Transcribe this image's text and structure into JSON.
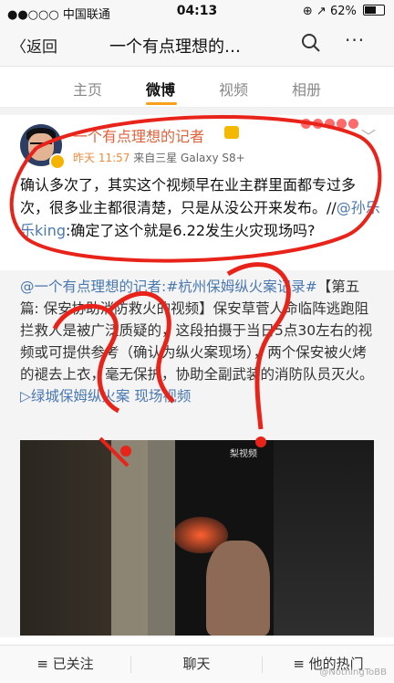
{
  "status_bar": {
    "carrier": "●●○○○ 中国联通",
    "wifi_icon": "wifi-icon",
    "time": "04:13",
    "indicators": "⊕ ↗",
    "battery_percent": "62%",
    "battery_level": 0.62
  },
  "nav": {
    "back_label": "〈返回",
    "title": "一个有点理想的…",
    "search_icon": "search-icon",
    "more_icon": "more-icon",
    "more_label": "···"
  },
  "tabs": [
    {
      "label": "主页"
    },
    {
      "label": "微博"
    },
    {
      "label": "视频"
    },
    {
      "label": "相册"
    }
  ],
  "post": {
    "username": "一个有点理想的记者",
    "time": "昨天 11:57",
    "source": "来自三星 Galaxy S8+",
    "body_prefix": "确认多次了，其实这个视频早在业主群里面都专过多次，很多业主都很清楚，只是从没公开来发布。//",
    "mention": "@孙乐乐king",
    "body_suffix": ":确定了这个就是6.22发生火灾现场吗?"
  },
  "repost": {
    "mention": "@一个有点理想的记者",
    "hashtag": ":#杭州保姆纵火案记录#",
    "text": "【第五篇: 保安协助消防救火的视频】保安草菅人命临阵逃跑阻拦救人是被广泛质疑的，这段拍摄于当日5点30左右的视频或可提供参考（确认为纵火案现场），两个保安被火烤的褪去上衣，毫无保护，协助全副武装的消防队员灭火。",
    "video_link": "▷绿城保姆纵火案 现场视频",
    "video_mark": "梨视频"
  },
  "bottom_bar": {
    "follow": "≡ 已关注",
    "chat": "聊天",
    "hot": "≡ 他的热门"
  },
  "watermark": "@NothingToBB",
  "colors": {
    "accent": "#f8a01a",
    "link": "#4a78b0",
    "username": "#e0623b",
    "annotation": "#e8231a"
  }
}
